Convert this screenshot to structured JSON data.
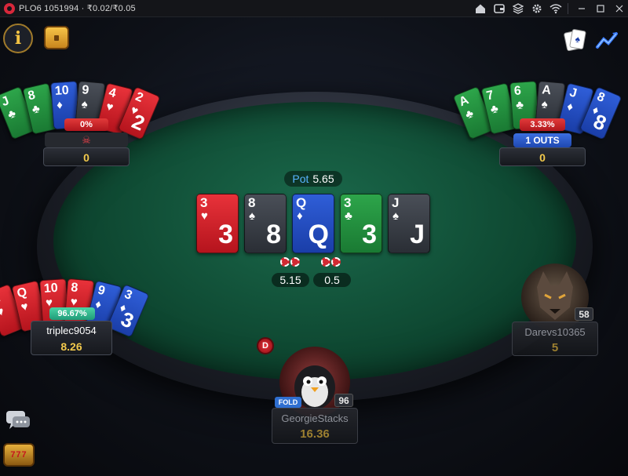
{
  "window": {
    "title": "PLO6 1051994 · ₹0.02/₹0.05",
    "icons": [
      "home-icon",
      "cashier-icon",
      "layers-icon",
      "settings-icon",
      "wifi-icon",
      "minimize-icon",
      "maximize-icon",
      "close-icon"
    ]
  },
  "table": {
    "pot_label": "Pot",
    "pot_value": "5.65",
    "board": [
      {
        "rank": "3",
        "suit": "♥",
        "color": "red"
      },
      {
        "rank": "8",
        "suit": "♠",
        "color": "black"
      },
      {
        "rank": "Q",
        "suit": "♦",
        "color": "blue"
      },
      {
        "rank": "3",
        "suit": "♣",
        "color": "green"
      },
      {
        "rank": "J",
        "suit": "♠",
        "color": "black"
      }
    ],
    "bets": [
      {
        "value": "5.15"
      },
      {
        "value": "0.5"
      }
    ],
    "dealer_label": "D"
  },
  "players": {
    "top_left": {
      "cards": [
        {
          "rank": "J",
          "suit": "♣",
          "color": "green"
        },
        {
          "rank": "8",
          "suit": "♣",
          "color": "green"
        },
        {
          "rank": "10",
          "suit": "♦",
          "color": "blue"
        },
        {
          "rank": "9",
          "suit": "♠",
          "color": "black"
        },
        {
          "rank": "4",
          "suit": "♥",
          "color": "red"
        },
        {
          "rank": "2",
          "suit": "♥",
          "color": "red"
        }
      ],
      "equity": "0%",
      "status_icon": "skull-icon",
      "stack": "0"
    },
    "top_right": {
      "cards": [
        {
          "rank": "A",
          "suit": "♣",
          "color": "green"
        },
        {
          "rank": "7",
          "suit": "♣",
          "color": "green"
        },
        {
          "rank": "6",
          "suit": "♣",
          "color": "green"
        },
        {
          "rank": "A",
          "suit": "♠",
          "color": "black"
        },
        {
          "rank": "J",
          "suit": "♦",
          "color": "blue"
        },
        {
          "rank": "8",
          "suit": "♦",
          "color": "blue"
        }
      ],
      "equity": "3.33%",
      "outs": "1 OUTS",
      "stack": "0"
    },
    "left": {
      "cards": [
        {
          "rank": "A",
          "suit": "♥",
          "color": "red"
        },
        {
          "rank": "Q",
          "suit": "♥",
          "color": "red"
        },
        {
          "rank": "10",
          "suit": "♥",
          "color": "red"
        },
        {
          "rank": "8",
          "suit": "♥",
          "color": "red"
        },
        {
          "rank": "9",
          "suit": "♦",
          "color": "blue"
        },
        {
          "rank": "3",
          "suit": "♦",
          "color": "blue"
        }
      ],
      "equity": "96.67%",
      "name": "triplec9054",
      "stack": "8.26"
    },
    "right": {
      "name": "Darevs10365",
      "stack": "5",
      "level": "58",
      "avatar": "wolf-avatar"
    },
    "bottom": {
      "name": "GeorgieStacks",
      "stack": "16.36",
      "level": "96",
      "status": "FOLD",
      "avatar": "penguin-avatar"
    }
  },
  "colors": {
    "felt": "#0f4a33",
    "accent_gold": "#f2c94c",
    "pot_label": "#58b4ff"
  }
}
